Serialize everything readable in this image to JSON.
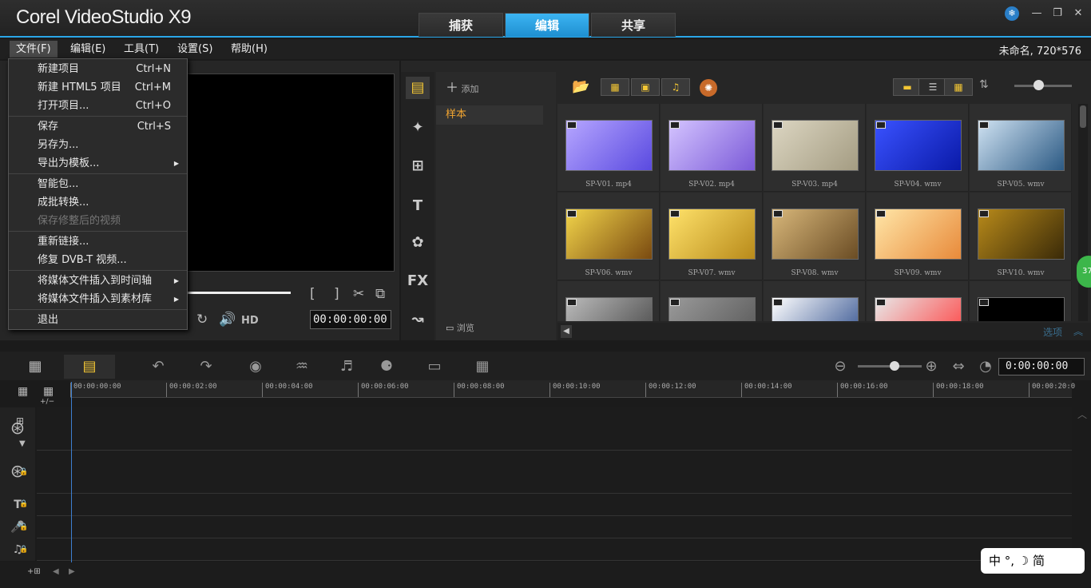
{
  "app": {
    "title": "Corel VideoStudio X9"
  },
  "mode_tabs": [
    {
      "label": "捕获"
    },
    {
      "label": "编辑"
    },
    {
      "label": "共享"
    }
  ],
  "window_controls": {
    "minimize": "—",
    "restore": "❐",
    "close": "✕"
  },
  "menubar": {
    "items": [
      {
        "label": "文件(F)"
      },
      {
        "label": "编辑(E)"
      },
      {
        "label": "工具(T)"
      },
      {
        "label": "设置(S)"
      },
      {
        "label": "帮助(H)"
      }
    ],
    "project_info": "未命名, 720*576"
  },
  "file_menu": {
    "items": [
      {
        "label": "新建项目",
        "shortcut": "Ctrl+N"
      },
      {
        "label": "新建 HTML5 项目",
        "shortcut": "Ctrl+M"
      },
      {
        "label": "打开项目...",
        "shortcut": "Ctrl+O"
      },
      {
        "label": "保存",
        "shortcut": "Ctrl+S"
      },
      {
        "label": "另存为...",
        "shortcut": ""
      },
      {
        "label": "导出为模板...",
        "shortcut": ""
      },
      {
        "label": "智能包...",
        "shortcut": ""
      },
      {
        "label": "成批转换...",
        "shortcut": ""
      },
      {
        "label": "保存修整后的视频",
        "shortcut": ""
      },
      {
        "label": "重新链接...",
        "shortcut": ""
      },
      {
        "label": "修复 DVB-T 视频...",
        "shortcut": ""
      },
      {
        "label": "将媒体文件插入到时间轴",
        "shortcut": ""
      },
      {
        "label": "将媒体文件插入到素材库",
        "shortcut": ""
      },
      {
        "label": "退出",
        "shortcut": ""
      }
    ]
  },
  "preview": {
    "timecode": "00:00:00:00",
    "hd_label": "HD"
  },
  "library": {
    "add_label": "添加",
    "browse_label": "浏览",
    "folders": [
      {
        "label": "样本"
      }
    ],
    "options_label": "选项",
    "thumbnails": [
      {
        "name": "SP-V01. mp4",
        "color1": "#b6a6ff",
        "color2": "#5a4ae0"
      },
      {
        "name": "SP-V02. mp4",
        "color1": "#d4c4ff",
        "color2": "#7b5ad8"
      },
      {
        "name": "SP-V03. mp4",
        "color1": "#dcd6c2",
        "color2": "#a49c82"
      },
      {
        "name": "SP-V04. wmv",
        "color1": "#3a52ff",
        "color2": "#0a1aa8"
      },
      {
        "name": "SP-V05. wmv",
        "color1": "#cfe2f2",
        "color2": "#2c5a84"
      },
      {
        "name": "SP-V06. wmv",
        "color1": "#f2d44a",
        "color2": "#7a4a10"
      },
      {
        "name": "SP-V07. wmv",
        "color1": "#ffe26a",
        "color2": "#b88a1a"
      },
      {
        "name": "SP-V08. wmv",
        "color1": "#d8b77a",
        "color2": "#6a4c24"
      },
      {
        "name": "SP-V09. wmv",
        "color1": "#ffe6a8",
        "color2": "#e88a3a"
      },
      {
        "name": "SP-V10. wmv",
        "color1": "#b88a1a",
        "color2": "#3a2a08"
      },
      {
        "name": "",
        "color1": "#bbbbbb",
        "color2": "#444444"
      },
      {
        "name": "",
        "color1": "#9a9a9a",
        "color2": "#555555"
      },
      {
        "name": "",
        "color1": "#ffffff",
        "color2": "#2a4a8a"
      },
      {
        "name": "",
        "color1": "#e8e8e8",
        "color2": "#ff3a3a"
      },
      {
        "name": "",
        "color1": "#000000",
        "color2": "#000000"
      }
    ]
  },
  "timeline": {
    "timecode": "0:00:00:00",
    "ruler_ticks": [
      "00:00:00:00",
      "00:00:02:00",
      "00:00:04:00",
      "00:00:06:00",
      "00:00:08:00",
      "00:00:10:00",
      "00:00:12:00",
      "00:00:14:00",
      "00:00:16:00",
      "00:00:18:00",
      "00:00:20:0"
    ],
    "add_remove_label": "+/−"
  },
  "ime": {
    "label": "中 °, ☽ 简"
  },
  "badge": {
    "value": "37"
  }
}
